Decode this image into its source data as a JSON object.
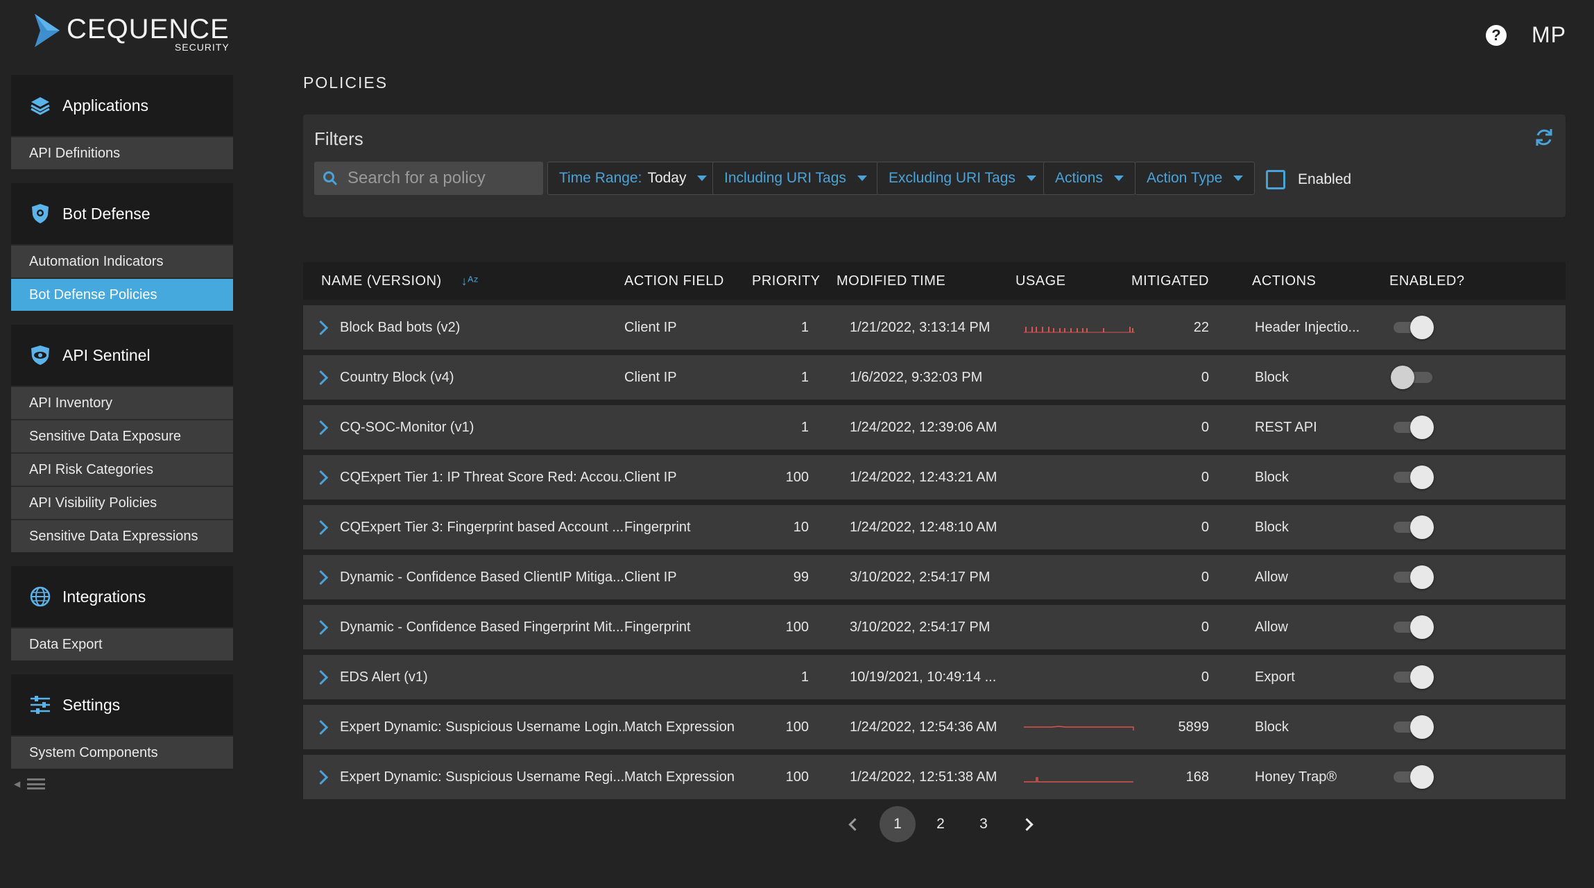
{
  "brand": {
    "name": "CEQUENCE",
    "sub": "SECURITY"
  },
  "header": {
    "help_icon": "question-icon",
    "help_label": "?",
    "user_initials": "MP"
  },
  "sidebar": {
    "sections": [
      {
        "title": "Applications",
        "icon": "layers-icon",
        "items": [
          "API Definitions"
        ]
      },
      {
        "title": "Bot Defense",
        "icon": "shield-icon",
        "items": [
          "Automation Indicators",
          "Bot Defense Policies"
        ]
      },
      {
        "title": "API Sentinel",
        "icon": "eye-shield-icon",
        "items": [
          "API Inventory",
          "Sensitive Data Exposure",
          "API Risk Categories",
          "API Visibility Policies",
          "Sensitive Data Expressions"
        ]
      },
      {
        "title": "Integrations",
        "icon": "globe-icon",
        "items": [
          "Data Export"
        ]
      },
      {
        "title": "Settings",
        "icon": "sliders-icon",
        "items": [
          "System Components"
        ]
      }
    ],
    "active_item": "Bot Defense Policies"
  },
  "page": {
    "title": "POLICIES"
  },
  "filters": {
    "title": "Filters",
    "search_placeholder": "Search for a policy",
    "time_range_label": "Time Range:",
    "time_range_value": "Today",
    "including_tags": "Including URI Tags",
    "excluding_tags": "Excluding URI Tags",
    "actions": "Actions",
    "action_type": "Action Type",
    "enabled_label": "Enabled",
    "accent": "#4aa3d8"
  },
  "table": {
    "headers": {
      "name": "NAME (VERSION)",
      "field": "ACTION FIELD",
      "priority": "PRIORITY",
      "modified": "MODIFIED TIME",
      "usage": "USAGE",
      "mitigated": "MITIGATED",
      "actions": "ACTIONS",
      "enabled": "ENABLED?"
    },
    "rows": [
      {
        "name": "Block Bad bots (v2)",
        "field": "Client IP",
        "priority": "1",
        "modified": "1/21/2022, 3:13:14 PM",
        "usage": "bars",
        "mitigated": "22",
        "action": "Header Injectio...",
        "enabled": true
      },
      {
        "name": "Country Block (v4)",
        "field": "Client IP",
        "priority": "1",
        "modified": "1/6/2022, 9:32:03 PM",
        "usage": "",
        "mitigated": "0",
        "action": "Block",
        "enabled": false
      },
      {
        "name": "CQ-SOC-Monitor (v1)",
        "field": "",
        "priority": "1",
        "modified": "1/24/2022, 12:39:06 AM",
        "usage": "",
        "mitigated": "0",
        "action": "REST API",
        "enabled": true
      },
      {
        "name": "CQExpert Tier 1: IP Threat Score Red: Accou...",
        "field": "Client IP",
        "priority": "100",
        "modified": "1/24/2022, 12:43:21 AM",
        "usage": "",
        "mitigated": "0",
        "action": "Block",
        "enabled": true
      },
      {
        "name": "CQExpert Tier 3: Fingerprint based Account ...",
        "field": "Fingerprint",
        "priority": "10",
        "modified": "1/24/2022, 12:48:10 AM",
        "usage": "",
        "mitigated": "0",
        "action": "Block",
        "enabled": true
      },
      {
        "name": "Dynamic - Confidence Based ClientIP Mitiga...",
        "field": "Client IP",
        "priority": "99",
        "modified": "3/10/2022, 2:54:17 PM",
        "usage": "",
        "mitigated": "0",
        "action": "Allow",
        "enabled": true
      },
      {
        "name": "Dynamic - Confidence Based Fingerprint Mit...",
        "field": "Fingerprint",
        "priority": "100",
        "modified": "3/10/2022, 2:54:17 PM",
        "usage": "",
        "mitigated": "0",
        "action": "Allow",
        "enabled": true
      },
      {
        "name": "EDS Alert (v1)",
        "field": "",
        "priority": "1",
        "modified": "10/19/2021, 10:49:14 ...",
        "usage": "",
        "mitigated": "0",
        "action": "Export",
        "enabled": true
      },
      {
        "name": "Expert Dynamic: Suspicious Username Login...",
        "field": "Match Expression",
        "priority": "100",
        "modified": "1/24/2022, 12:54:36 AM",
        "usage": "line",
        "mitigated": "5899",
        "action": "Block",
        "enabled": true
      },
      {
        "name": "Expert Dynamic: Suspicious Username Regi...",
        "field": "Match Expression",
        "priority": "100",
        "modified": "1/24/2022, 12:51:38 AM",
        "usage": "spike",
        "mitigated": "168",
        "action": "Honey Trap®",
        "enabled": true
      }
    ]
  },
  "pagination": {
    "pages": [
      "1",
      "2",
      "3"
    ],
    "current": "1"
  }
}
